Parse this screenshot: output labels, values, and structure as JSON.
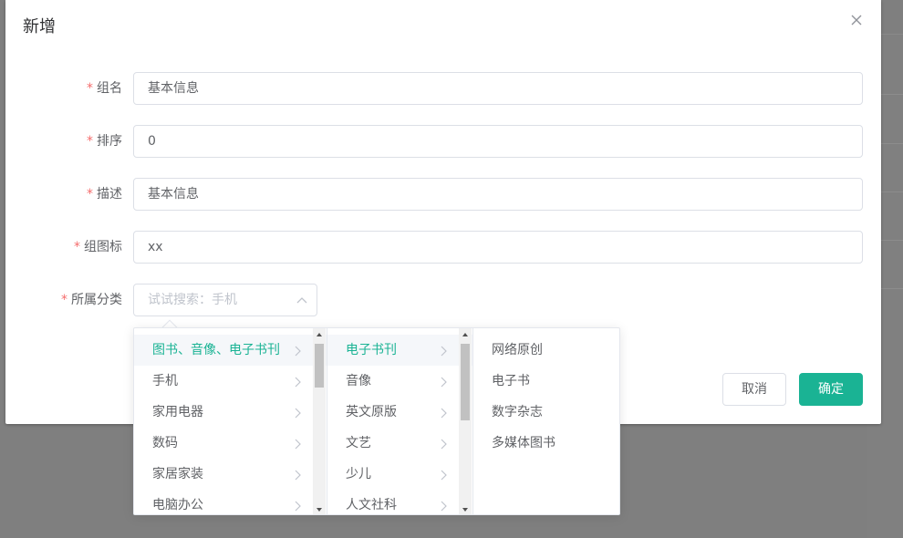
{
  "dialog": {
    "title": "新增",
    "close_icon": "close-icon"
  },
  "form": {
    "required_mark": "*",
    "group_name": {
      "label": "组名",
      "value": "基本信息"
    },
    "sort": {
      "label": "排序",
      "value": "0"
    },
    "description": {
      "label": "描述",
      "value": "基本信息"
    },
    "group_icon": {
      "label": "组图标",
      "value": "xx"
    },
    "category": {
      "label": "所属分类",
      "placeholder": "试试搜索：手机",
      "arrow_icon": "chevron-up-icon"
    }
  },
  "buttons": {
    "cancel": "取消",
    "confirm": "确定"
  },
  "cascader": {
    "level1": [
      {
        "label": "图书、音像、电子书刊",
        "active": true
      },
      {
        "label": "手机",
        "active": false
      },
      {
        "label": "家用电器",
        "active": false
      },
      {
        "label": "数码",
        "active": false
      },
      {
        "label": "家居家装",
        "active": false
      },
      {
        "label": "电脑办公",
        "active": false
      }
    ],
    "level2": [
      {
        "label": "电子书刊",
        "active": true
      },
      {
        "label": "音像",
        "active": false
      },
      {
        "label": "英文原版",
        "active": false
      },
      {
        "label": "文艺",
        "active": false
      },
      {
        "label": "少儿",
        "active": false
      },
      {
        "label": "人文社科",
        "active": false
      }
    ],
    "level3": [
      {
        "label": "网络原创"
      },
      {
        "label": "电子书"
      },
      {
        "label": "数字杂志"
      },
      {
        "label": "多媒体图书"
      }
    ]
  },
  "colors": {
    "accent": "#1ab394",
    "required": "#f56c6c"
  }
}
